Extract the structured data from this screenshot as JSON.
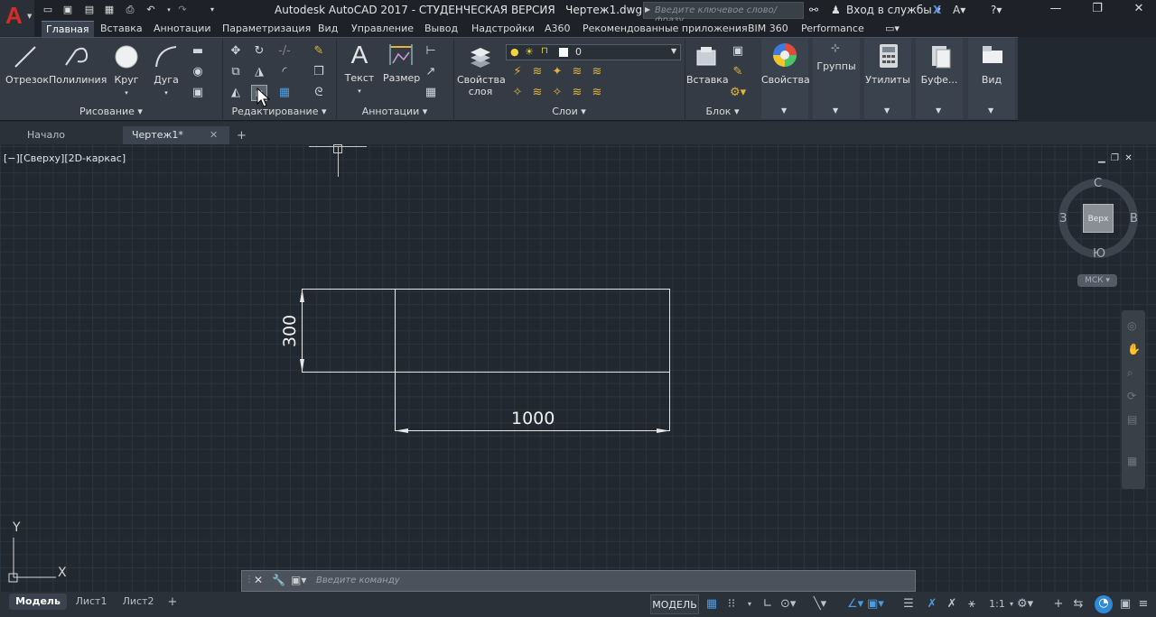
{
  "app": {
    "logo_letter": "A",
    "title": "Autodesk AutoCAD 2017 - СТУДЕНЧЕСКАЯ ВЕРСИЯ",
    "file": "Чертеж1.dwg",
    "search_placeholder": "Введите ключевое слово/фразу",
    "signin": "Вход в службы"
  },
  "menu_tabs": [
    "Главная",
    "Вставка",
    "Аннотации",
    "Параметризация",
    "Вид",
    "Управление",
    "Вывод",
    "Надстройки",
    "A360",
    "Рекомендованные приложения",
    "BIM 360",
    "Performance"
  ],
  "ribbon": {
    "draw": {
      "line": "Отрезок",
      "polyline": "Полилиния",
      "circle": "Круг",
      "arc": "Дуга",
      "footer": "Рисование"
    },
    "modify": {
      "footer": "Редактирование"
    },
    "annotation": {
      "text": "Текст",
      "dimension": "Размер",
      "footer": "Аннотации"
    },
    "layers": {
      "props1": "Свойства",
      "props2": "слоя",
      "layer_value": "0",
      "footer": "Слои"
    },
    "block": {
      "insert": "Вставка",
      "footer": "Блок"
    },
    "properties": {
      "label": "Свойства"
    },
    "groups": {
      "label": "Группы"
    },
    "utilities": {
      "label": "Утилиты"
    },
    "clipboard": {
      "label": "Буфе..."
    },
    "view": {
      "label": "Вид"
    }
  },
  "file_tabs": [
    "Начало",
    "Чертеж1*"
  ],
  "viewport": {
    "controls": "[−][Сверху][2D-каркас]",
    "viewcube": {
      "top": "Верх",
      "north": "С",
      "south": "Ю",
      "west": "З",
      "east": "В"
    },
    "wcs": "МСК",
    "dim_vertical": "300",
    "dim_horizontal": "1000",
    "ucs_x": "X",
    "ucs_y": "Y"
  },
  "command": {
    "placeholder": "Введите команду"
  },
  "layout_tabs": [
    "Модель",
    "Лист1",
    "Лист2"
  ],
  "status": {
    "model": "МОДЕЛЬ",
    "scale": "1:1"
  },
  "colors": {
    "background": "#212830",
    "ribbon": "#343b45",
    "accent": "#d22d27",
    "status_blue": "#2f8bd6"
  }
}
